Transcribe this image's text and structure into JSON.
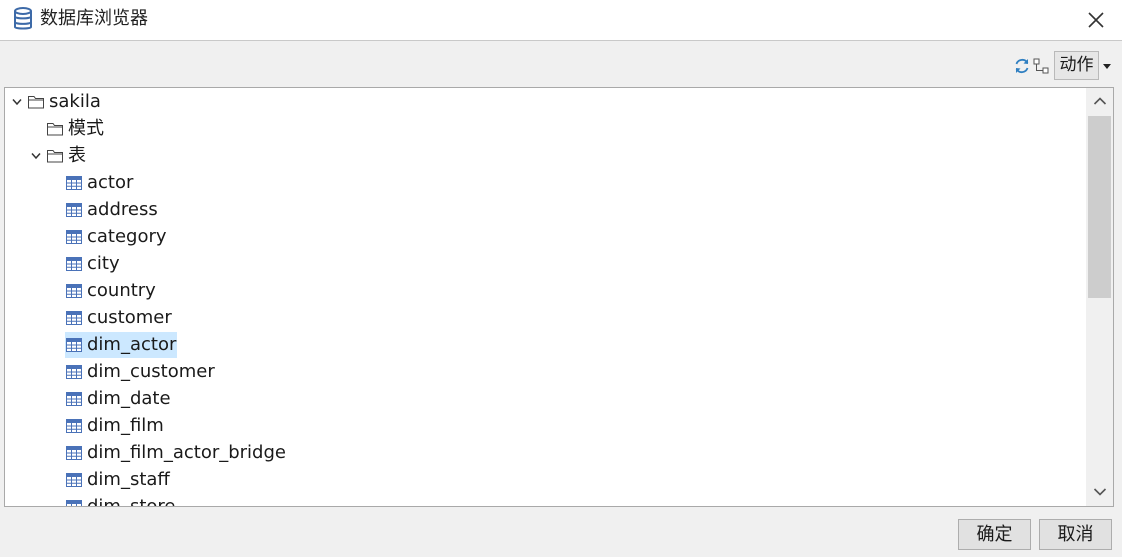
{
  "window": {
    "title": "数据库浏览器",
    "icon": "database-icon"
  },
  "toolbar": {
    "refresh_icon": "refresh-icon",
    "hierarchy_icon": "hierarchy-icon",
    "action_label": "动作",
    "action_caret_icon": "caret-down-icon"
  },
  "tree": {
    "root": {
      "label": "sakila",
      "expanded": true
    },
    "schemas": {
      "label": "模式",
      "expanded": false
    },
    "tables": {
      "label": "表",
      "expanded": true
    },
    "table_items": [
      "actor",
      "address",
      "category",
      "city",
      "country",
      "customer",
      "dim_actor",
      "dim_customer",
      "dim_date",
      "dim_film",
      "dim_film_actor_bridge",
      "dim_staff",
      "dim_store"
    ],
    "selected": "dim_actor"
  },
  "colors": {
    "selection": "#cce8ff",
    "table_icon": "#4a72b8",
    "database_icon": "#3d6aa8"
  },
  "footer": {
    "ok_label": "确定",
    "cancel_label": "取消"
  }
}
